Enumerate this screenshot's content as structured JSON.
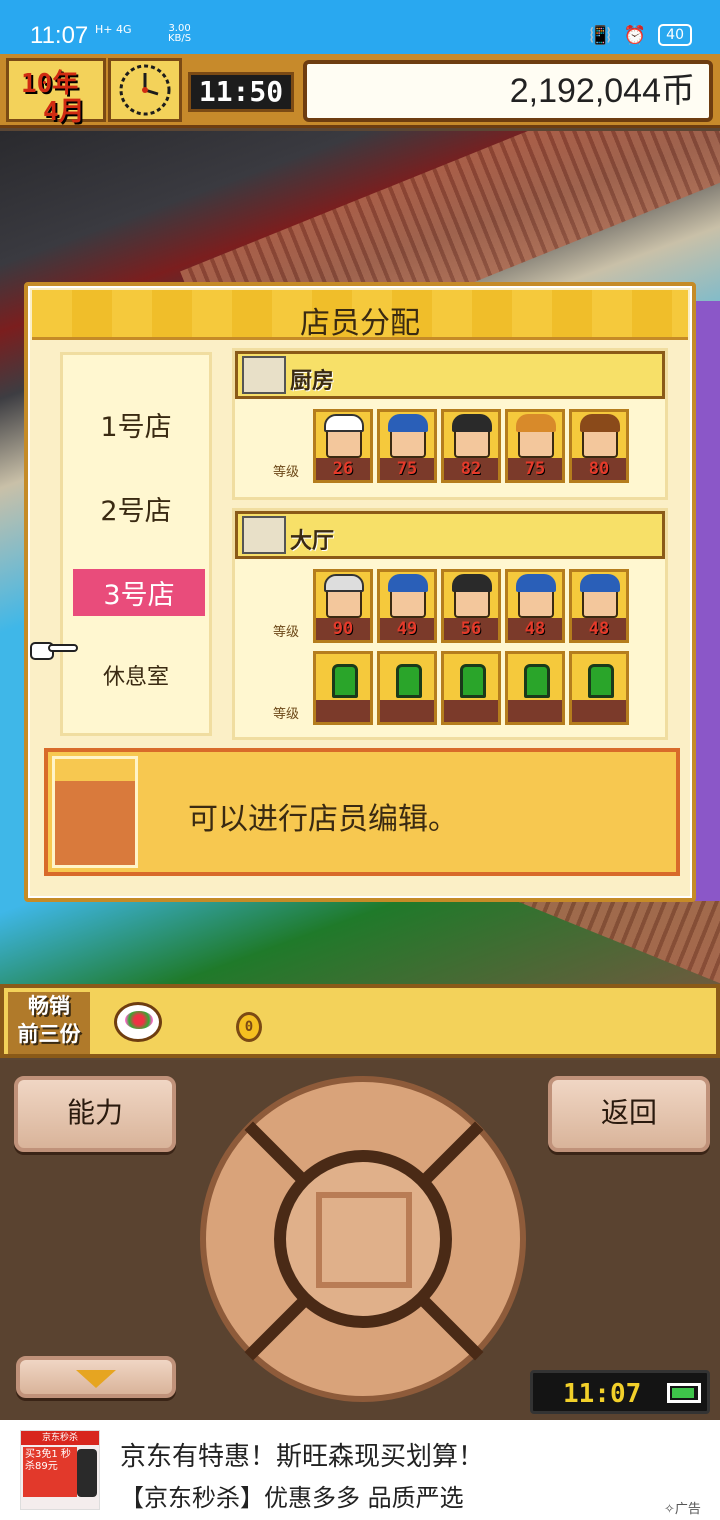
{
  "status_bar": {
    "time": "11:07",
    "network": "H+ 4G",
    "speed": "3.00",
    "speed_unit": "KB/S",
    "battery": "40"
  },
  "hud": {
    "year": "10年",
    "month": "4月",
    "game_time": "11:50",
    "money": "2,192,044币"
  },
  "dialog": {
    "title": "店员分配",
    "stores": [
      {
        "label": "1号店",
        "selected": false
      },
      {
        "label": "2号店",
        "selected": false
      },
      {
        "label": "3号店",
        "selected": true
      },
      {
        "label": "休息室",
        "selected": false
      }
    ],
    "kitchen": {
      "label": "厨房",
      "level_label": "等级",
      "staff_levels": [
        "26",
        "75",
        "82",
        "75",
        "80"
      ]
    },
    "hall": {
      "label": "大厅",
      "level_label": "等级",
      "staff_levels": [
        "90",
        "49",
        "56",
        "48",
        "48"
      ],
      "empty_level_label": "等级",
      "empty_slots": 5
    },
    "message": "可以进行店员编辑。"
  },
  "bestseller": {
    "label_line1": "畅销",
    "label_line2": "前三份",
    "coin_text": "0"
  },
  "controls": {
    "ability": "能力",
    "back": "返回",
    "clock": "11:07"
  },
  "ad": {
    "title": "京东有特惠！斯旺森现买划算！",
    "subtitle": "【京东秒杀】优惠多多 品质严选",
    "label": "广告",
    "image_tag": "京东秒杀",
    "image_promo": "买3免1 秒杀89元"
  },
  "colors": {
    "selected_store": "#e94c7b",
    "panel": "#fbefc6",
    "header": "#f5c93c",
    "status_bar": "#29a8f0"
  }
}
